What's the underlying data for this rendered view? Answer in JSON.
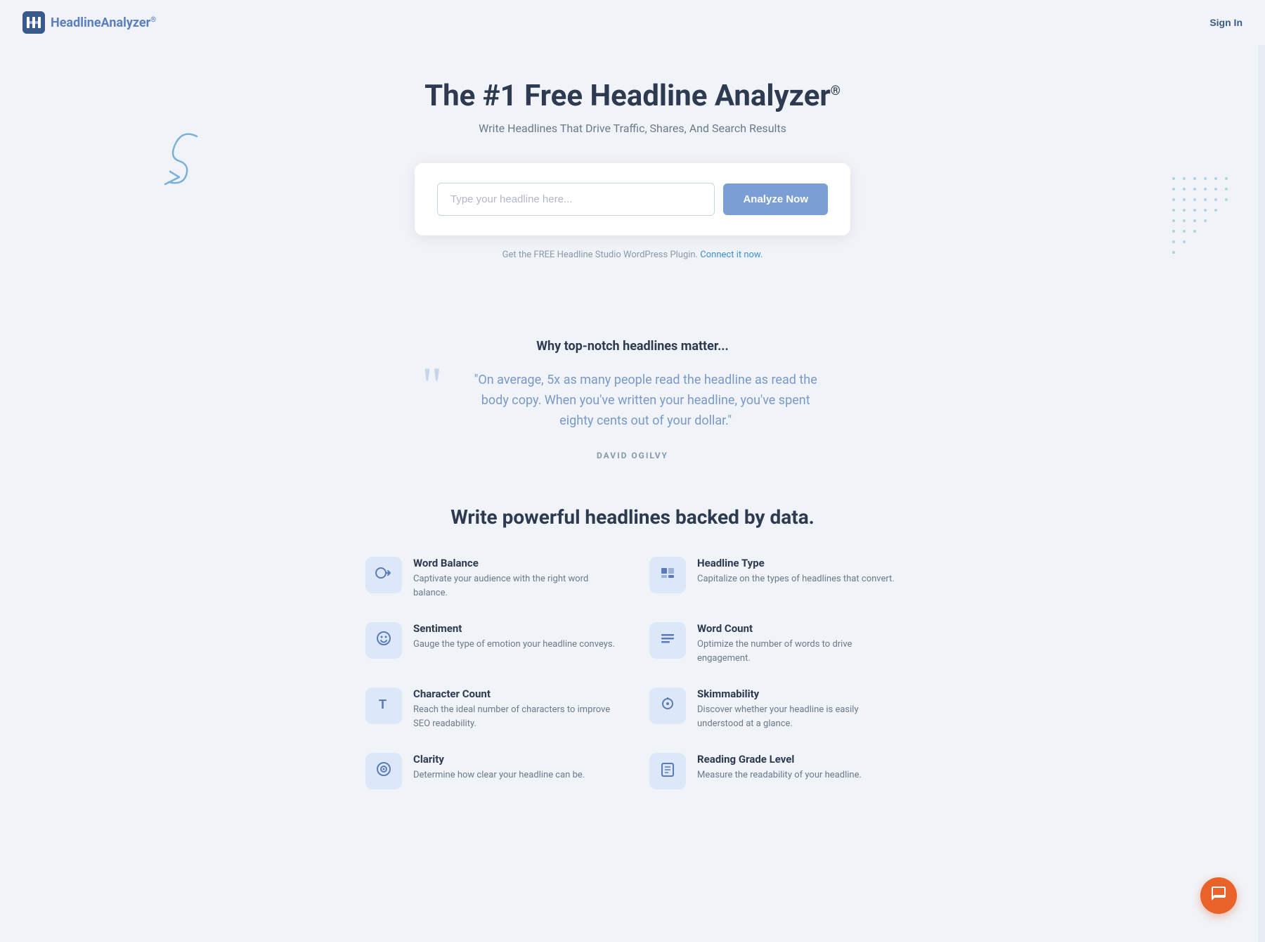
{
  "header": {
    "logo_text_1": "Headline",
    "logo_text_2": "Analyzer",
    "logo_reg": "®",
    "sign_in_label": "Sign In"
  },
  "hero": {
    "title": "The #1 Free Headline Analyzer",
    "title_reg": "®",
    "subtitle": "Write Headlines That Drive Traffic, Shares, And Search Results",
    "input_placeholder": "Type your headline here...",
    "analyze_button_label": "Analyze Now",
    "plugin_text": "Get the FREE Headline Studio WordPress Plugin.",
    "plugin_link_text": "Connect it now."
  },
  "why_section": {
    "title": "Why top-notch headlines matter...",
    "quote": "\"On average, 5x as many people read the headline as read the body copy. When you've written your headline, you've spent eighty cents out of your dollar.\"",
    "author": "DAVID OGILVY"
  },
  "features_section": {
    "title": "Write powerful headlines backed by data.",
    "features": [
      {
        "name": "Word Balance",
        "desc": "Captivate your audience with the right word balance.",
        "icon": "◕",
        "id": "word-balance"
      },
      {
        "name": "Headline Type",
        "desc": "Capitalize on the types of headlines that convert.",
        "icon": "⊞",
        "id": "headline-type"
      },
      {
        "name": "Sentiment",
        "desc": "Gauge the type of emotion your headline conveys.",
        "icon": "☺",
        "id": "sentiment"
      },
      {
        "name": "Word Count",
        "desc": "Optimize the number of words to drive engagement.",
        "icon": "≡",
        "id": "word-count"
      },
      {
        "name": "Character Count",
        "desc": "Reach the ideal number of characters to improve SEO readability.",
        "icon": "T",
        "id": "character-count"
      },
      {
        "name": "Skimmability",
        "desc": "Discover whether your headline is easily understood at a glance.",
        "icon": "⌕",
        "id": "skimmability"
      },
      {
        "name": "Clarity",
        "desc": "Determine how clear your headline can be.",
        "icon": "◎",
        "id": "clarity"
      },
      {
        "name": "Reading Grade Level",
        "desc": "Measure the readability of your headline.",
        "icon": "▤",
        "id": "reading-grade-level"
      }
    ]
  },
  "chat_button_label": "💬",
  "colors": {
    "accent_blue": "#7a9fd4",
    "brand_dark": "#2d3a50",
    "logo_color": "#3a5a8a",
    "icon_bg": "#dce8f8",
    "icon_color": "#5a7ab8",
    "quote_color": "#7a99c8",
    "chat_orange": "#e8622a"
  }
}
